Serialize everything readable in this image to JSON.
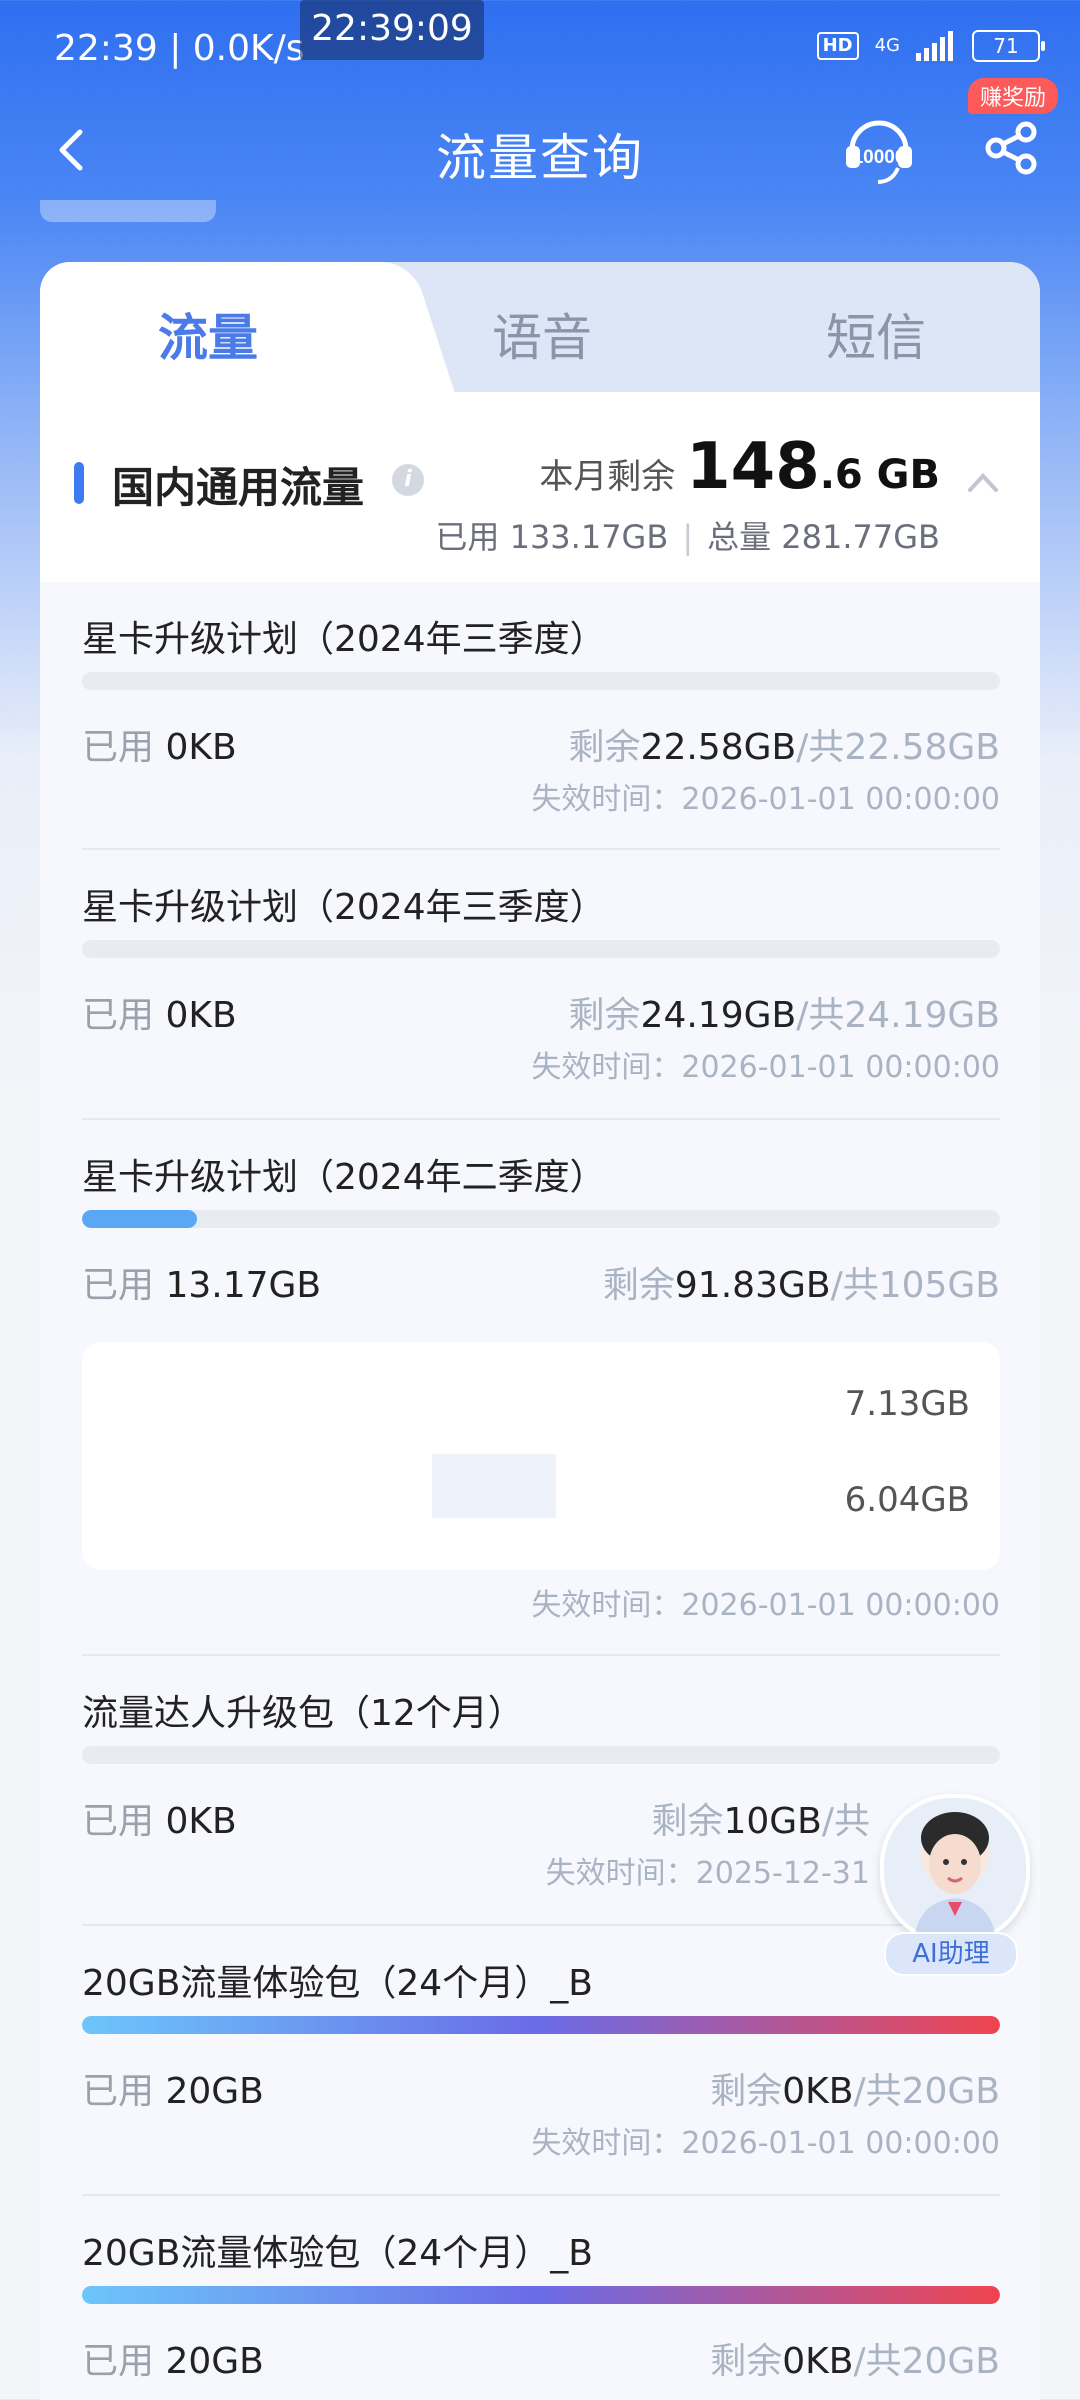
{
  "status_bar": {
    "time": "22:39 | 0.0K/s",
    "overlay_clock": "22:39:09",
    "hd": "HD",
    "network": "4G",
    "battery": "71"
  },
  "nav": {
    "title": "流量查询",
    "reward_badge": "赚奖励"
  },
  "tabs": [
    {
      "label": "流量",
      "active": true
    },
    {
      "label": "语音",
      "active": false
    },
    {
      "label": "短信",
      "active": false
    }
  ],
  "summary": {
    "name": "国内通用流量",
    "remain_label": "本月剩余",
    "remain_big": "148",
    "remain_small": ".6 GB",
    "used": "已用 133.17GB",
    "total": "总量 281.77GB"
  },
  "items": [
    {
      "name": "星卡升级计划（2024年三季度）",
      "used_label": "已用",
      "used": "0KB",
      "remain_label": "剩余",
      "remain": "22.58GB",
      "total": "/共22.58GB",
      "expire": "失效时间：2026-01-01 00:00:00",
      "fill": 0
    },
    {
      "name": "星卡升级计划（2024年三季度）",
      "used_label": "已用",
      "used": "0KB",
      "remain_label": "剩余",
      "remain": "24.19GB",
      "total": "/共24.19GB",
      "expire": "失效时间：2026-01-01 00:00:00",
      "fill": 0
    },
    {
      "name": "星卡升级计划（2024年二季度）",
      "used_label": "已用",
      "used": "13.17GB",
      "remain_label": "剩余",
      "remain": "91.83GB",
      "total": "/共105GB",
      "expire": "失效时间：2026-01-01 00:00:00",
      "fill": 0.125,
      "sub_values": [
        "7.13GB",
        "6.04GB"
      ]
    },
    {
      "name": "流量达人升级包（12个月）",
      "used_label": "已用",
      "used": "0KB",
      "remain_label": "剩余",
      "remain": "10GB",
      "total": "/共",
      "expire": "失效时间：2025-12-31",
      "fill": 0
    },
    {
      "name": "20GB流量体验包（24个月）_B",
      "used_label": "已用",
      "used": "20GB",
      "remain_label": "剩余",
      "remain": "0KB",
      "total": "/共20GB",
      "expire": "失效时间：2026-01-01 00:00:00",
      "fill": 1
    },
    {
      "name": "20GB流量体验包（24个月）_B",
      "used_label": "已用",
      "used": "20GB",
      "remain_label": "剩余",
      "remain": "0KB",
      "total": "/共20GB",
      "expire": "",
      "fill": 1
    }
  ],
  "ai_assistant": {
    "label": "AI助理"
  },
  "colors": {
    "accent": "#3e7bf0",
    "blue_fill": "#5aa8f5",
    "gradient_start": "#6cc6fb",
    "gradient_mid": "#6a6ae6",
    "gradient_end": "#f0444f"
  }
}
